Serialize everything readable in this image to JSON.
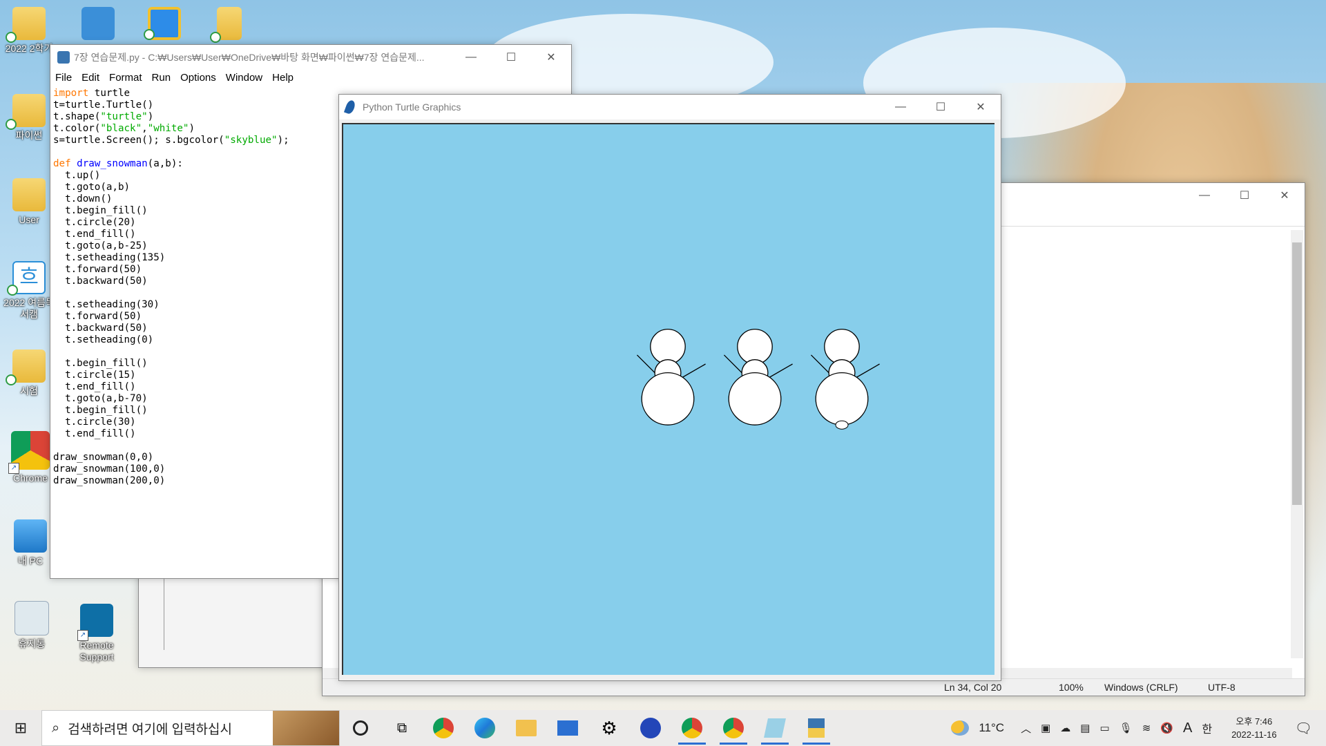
{
  "desktop": {
    "icons": [
      {
        "label": "2022 2학기"
      },
      {
        "label": ""
      },
      {
        "label": ""
      },
      {
        "label": ""
      },
      {
        "label": "파이썬"
      },
      {
        "label": "User"
      },
      {
        "label": "2022 여름독서캠"
      },
      {
        "label": "시험"
      },
      {
        "label": "Chrome"
      },
      {
        "label": "내 PC"
      },
      {
        "label": "휴지통"
      },
      {
        "label": "Remote Support"
      }
    ]
  },
  "idle_window": {
    "title": "7장 연습문제.py - C:₩Users₩User₩OneDrive₩바탕 화면₩파이썬₩7장 연습문제...",
    "menu": [
      "File",
      "Edit",
      "Format",
      "Run",
      "Options",
      "Window",
      "Help"
    ],
    "code_lines": [
      "import turtle",
      "t=turtle.Turtle()",
      "t.shape(\"turtle\")",
      "t.color(\"black\",\"white\")",
      "s=turtle.Screen(); s.bgcolor(\"skyblue\");",
      "",
      "def draw_snowman(a,b):",
      "  t.up()",
      "  t.goto(a,b)",
      "  t.down()",
      "  t.begin_fill()",
      "  t.circle(20)",
      "  t.end_fill()",
      "  t.goto(a,b-25)",
      "  t.setheading(135)",
      "  t.forward(50)",
      "  t.backward(50)",
      "",
      "  t.setheading(30)",
      "  t.forward(50)",
      "  t.backward(50)",
      "  t.setheading(0)",
      "",
      "  t.begin_fill()",
      "  t.circle(15)",
      "  t.end_fill()",
      "  t.goto(a,b-70)",
      "  t.begin_fill()",
      "  t.circle(30)",
      "  t.end_fill()",
      "",
      "draw_snowman(0,0)",
      "draw_snowman(100,0)",
      "draw_snowman(200,0)"
    ]
  },
  "turtle_window": {
    "title": "Python Turtle Graphics",
    "bgcolor": "#87ceeb",
    "snowmen": [
      {
        "a": 0,
        "b": 0
      },
      {
        "a": 100,
        "b": 0
      },
      {
        "a": 200,
        "b": 0
      }
    ]
  },
  "notepad_window": {
    "status": {
      "position": "Ln 34, Col 20",
      "zoom": "100%",
      "line_ending": "Windows (CRLF)",
      "encoding": "UTF-8"
    }
  },
  "taskbar": {
    "search_placeholder": "검색하려면 여기에 입력하십시",
    "weather": "11°C",
    "ime": "A",
    "lang": "한",
    "time": "오후 7:46",
    "date": "2022-11-16"
  }
}
